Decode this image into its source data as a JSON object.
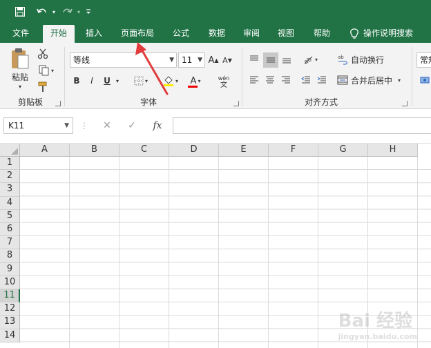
{
  "quick_access": {
    "save_icon": "save-icon",
    "undo_icon": "undo-icon",
    "redo_icon": "redo-icon",
    "customize_icon": "customize-qat-icon"
  },
  "tabs": [
    {
      "label": "文件"
    },
    {
      "label": "开始",
      "active": true
    },
    {
      "label": "插入"
    },
    {
      "label": "页面布局"
    },
    {
      "label": "公式"
    },
    {
      "label": "数据"
    },
    {
      "label": "审阅"
    },
    {
      "label": "视图"
    },
    {
      "label": "帮助"
    }
  ],
  "tell_me": {
    "label": "操作说明搜索"
  },
  "ribbon": {
    "clipboard": {
      "label": "剪贴板",
      "paste_label": "粘贴"
    },
    "font": {
      "label": "字体",
      "font_name": "等线",
      "font_size": "11",
      "bold": "B",
      "italic": "I",
      "underline": "U",
      "grow": "A",
      "shrink": "A",
      "font_color": "A",
      "phonetic_top": "wén",
      "phonetic_bottom": "文"
    },
    "alignment": {
      "label": "对齐方式",
      "wrap_text": "自动换行",
      "merge_center": "合并后居中"
    },
    "number": {
      "format": "常规"
    }
  },
  "formula_bar": {
    "name_box": "K11",
    "cancel": "✕",
    "enter": "✓",
    "fx": "fx",
    "value": ""
  },
  "sheet": {
    "columns": [
      "A",
      "B",
      "C",
      "D",
      "E",
      "F",
      "G",
      "H"
    ],
    "rows": [
      "1",
      "2",
      "3",
      "4",
      "5",
      "6",
      "7",
      "8",
      "9",
      "10",
      "11",
      "12",
      "13",
      "14"
    ],
    "selected_row": "11"
  },
  "watermark": {
    "text": "Bai 经验",
    "sub": "jingyan.baidu.com"
  },
  "colors": {
    "accent": "#217346",
    "annotation_arrow": "#e23b3b"
  }
}
